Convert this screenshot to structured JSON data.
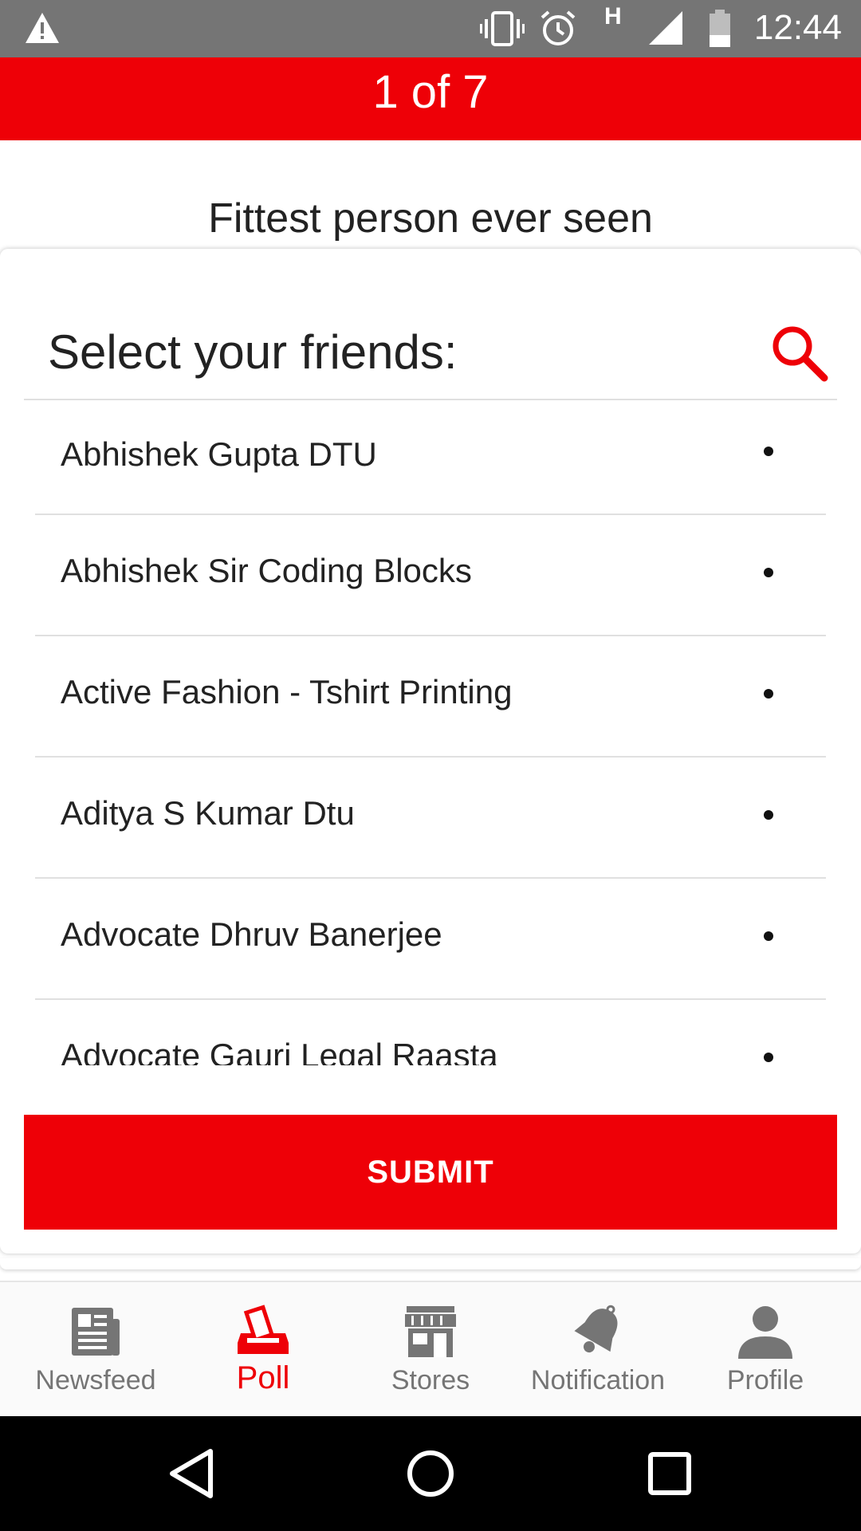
{
  "status_bar": {
    "time": "12:44",
    "network": "H",
    "icons": [
      "warning-icon",
      "vibrate-icon",
      "alarm-icon",
      "signal-icon",
      "battery-icon"
    ]
  },
  "poll": {
    "progress": "1 of 7",
    "question": "Fittest person ever seen"
  },
  "card": {
    "select_label": "Select your friends:",
    "search_icon": "search-icon",
    "friends": [
      "Abhishek Gupta DTU",
      "Abhishek Sir Coding Blocks",
      "Active Fashion - Tshirt Printing",
      "Aditya S Kumar Dtu",
      "Advocate Dhruv Banerjee",
      "Advocate Gauri Legal Raasta"
    ],
    "submit_label": "SUBMIT"
  },
  "bottom_nav": {
    "items": [
      {
        "label": "Newsfeed",
        "icon": "newsfeed-icon"
      },
      {
        "label": "Poll",
        "icon": "poll-icon",
        "active": true
      },
      {
        "label": "Stores",
        "icon": "stores-icon"
      },
      {
        "label": "Notification",
        "icon": "notification-bell-icon"
      },
      {
        "label": "Profile",
        "icon": "profile-icon"
      }
    ]
  },
  "colors": {
    "accent": "#ee0007",
    "status_bar": "#757575",
    "nav_inactive": "#757575"
  }
}
